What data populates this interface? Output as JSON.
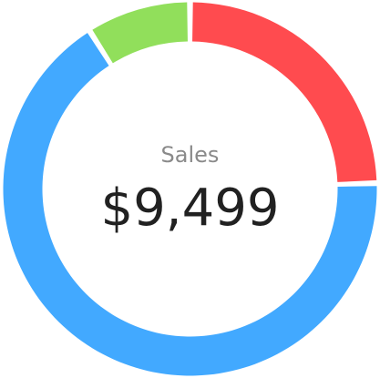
{
  "chart_data": {
    "type": "pie",
    "style": "donut",
    "title": "Sales",
    "center_value": "$9,499",
    "slices": [
      {
        "value": 24.5,
        "color": "#FF4B4F"
      },
      {
        "value": 66.5,
        "color": "#42A9FF"
      },
      {
        "value": 9.0,
        "color": "#91DF5B"
      }
    ],
    "start_angle_deg": 0,
    "gap_deg": 1.8,
    "legend": "none"
  }
}
